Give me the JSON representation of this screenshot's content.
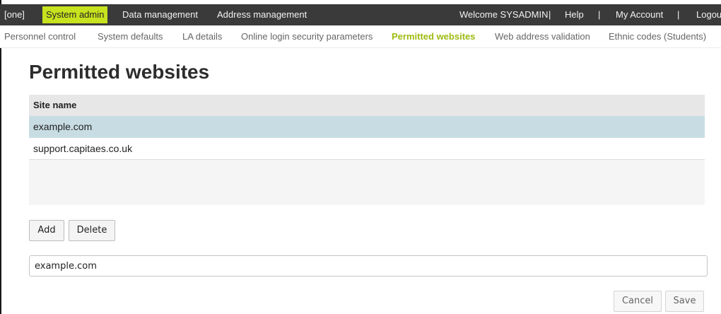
{
  "topbar": {
    "brand": "[one]",
    "active_menu": "System admin",
    "menu_data_management": "Data management",
    "menu_address_management": "Address management",
    "welcome": "Welcome SYSADMIN",
    "separator": "|",
    "help": "Help",
    "my_account": "My Account",
    "logout": "Logout"
  },
  "subnav": {
    "items": [
      "Personnel control",
      "System defaults",
      "LA details",
      "Online login security parameters",
      "Permitted websites",
      "Web address validation",
      "Ethnic codes (Students)"
    ],
    "active_index": 4
  },
  "page": {
    "title": "Permitted websites"
  },
  "grid": {
    "column_header": "Site name",
    "rows": [
      "example.com",
      "support.capitaes.co.uk"
    ],
    "selected_index": 0
  },
  "buttons": {
    "add": "Add",
    "delete": "Delete",
    "cancel": "Cancel",
    "save": "Save"
  },
  "site_input": {
    "value": "example.com"
  },
  "colors": {
    "topbar_bg": "#3a3a3a",
    "accent": "#c7e21e",
    "active_subnav": "#9dbb12",
    "selected_row": "#c8dde3"
  }
}
